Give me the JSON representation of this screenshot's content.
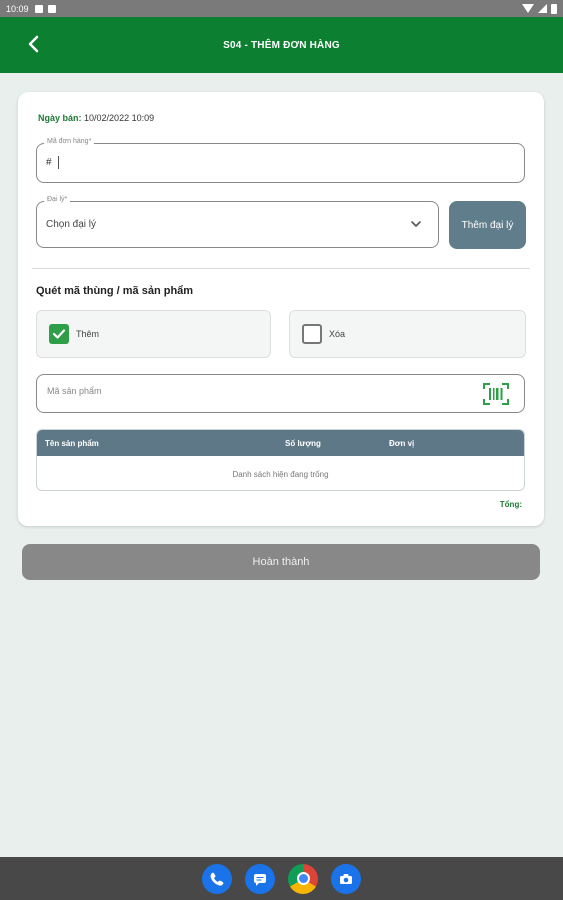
{
  "status_bar": {
    "time": "10:09"
  },
  "app_bar": {
    "title": "S04 - THÊM ĐƠN HÀNG"
  },
  "form": {
    "sale_date_label": "Ngày bán:",
    "sale_date_value": "10/02/2022 10:09",
    "order_code": {
      "label": "Mã đơn hàng*",
      "prefix": "#"
    },
    "agent": {
      "label": "Đại lý*",
      "placeholder": "Chọn đại lý"
    },
    "add_agent_label": "Thêm đại lý",
    "scan_section_title": "Quét mã thùng / mã sản phẩm",
    "modes": {
      "add_label": "Thêm",
      "add_checked": true,
      "delete_label": "Xóa",
      "delete_checked": false
    },
    "product_code": {
      "placeholder": "Mã sản phẩm"
    },
    "table": {
      "columns": [
        "Tên sản phẩm",
        "Số lượng",
        "Đơn vị"
      ],
      "rows": [],
      "empty_text": "Danh sách hiện đang trống"
    },
    "total_label": "Tổng:"
  },
  "finish_label": "Hoàn thành",
  "colors": {
    "primary": "#0c7f30",
    "secondary_button": "#607d8b",
    "disabled_button": "#888888",
    "table_header": "#5f7887"
  },
  "dock": {
    "apps": [
      {
        "icon": "phone-icon"
      },
      {
        "icon": "messages-icon"
      },
      {
        "icon": "chrome-icon"
      },
      {
        "icon": "camera-icon"
      }
    ]
  }
}
